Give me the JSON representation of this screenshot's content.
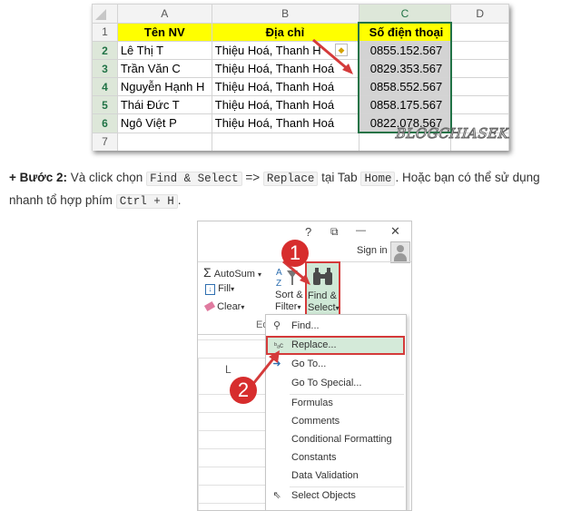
{
  "spreadsheet": {
    "columns": [
      "A",
      "B",
      "C",
      "D"
    ],
    "rows": [
      {
        "num": "1",
        "cells": [
          "Tên NV",
          "Địa chỉ",
          "Số điện thoại",
          ""
        ]
      },
      {
        "num": "2",
        "cells": [
          "Lê Thị T",
          "Thiệu Hoá, Thanh H",
          "0855.152.567",
          ""
        ]
      },
      {
        "num": "3",
        "cells": [
          "Trần Văn C",
          "Thiệu Hoá, Thanh Hoá",
          "0829.353.567",
          ""
        ]
      },
      {
        "num": "4",
        "cells": [
          "Nguyễn Hạnh H",
          "Thiệu Hoá, Thanh Hoá",
          "0858.552.567",
          ""
        ]
      },
      {
        "num": "5",
        "cells": [
          "Thái Đức T",
          "Thiệu Hoá, Thanh Hoá",
          "0858.175.567",
          ""
        ]
      },
      {
        "num": "6",
        "cells": [
          "Ngô Việt P",
          "Thiệu Hoá, Thanh Hoá",
          "0822.078.567",
          ""
        ]
      },
      {
        "num": "7",
        "cells": [
          "",
          "",
          "",
          ""
        ]
      }
    ],
    "watermark": "BLOGCHIASEKIENTHUC.COM"
  },
  "instruction": {
    "step_label": "+ Bước 2:",
    "text1": " Và click chọn ",
    "code1": "Find & Select",
    "text2": " => ",
    "code2": "Replace",
    "text3": " tại Tab ",
    "code3": "Home",
    "text4": ". Hoặc bạn có thể sử dụng nhanh tổ hợp phím ",
    "code4": "Ctrl + H",
    "text5": "."
  },
  "ribbon": {
    "help": "?",
    "restore": "⧉",
    "minimize": "—",
    "close": "✕",
    "sign_in": "Sign in",
    "autosum": "AutoSum",
    "fill": "Fill",
    "clear": "Clear",
    "sort_filter_1": "Sort &",
    "sort_filter_2": "Filter",
    "find_select_1": "Find &",
    "find_select_2": "Select",
    "group_label": "Ed",
    "col_letter": "L",
    "badge1": "1",
    "badge2": "2",
    "menu": [
      {
        "icon": "binoculars-icon",
        "label": "Find..."
      },
      {
        "icon": "replace-icon",
        "label": "Replace..."
      },
      {
        "icon": "goto-arrow-icon",
        "label": "Go To..."
      },
      {
        "icon": "",
        "label": "Go To Special..."
      },
      {
        "icon": "",
        "label": "Formulas"
      },
      {
        "icon": "",
        "label": "Comments"
      },
      {
        "icon": "",
        "label": "Conditional Formatting"
      },
      {
        "icon": "",
        "label": "Constants"
      },
      {
        "icon": "",
        "label": "Data Validation"
      },
      {
        "icon": "cursor-icon",
        "label": "Select Objects"
      }
    ]
  },
  "colors": {
    "accent_green": "#217346",
    "highlight_red": "#d43a3a",
    "badge_red": "#d72d2d",
    "yellow": "#ffff00"
  }
}
